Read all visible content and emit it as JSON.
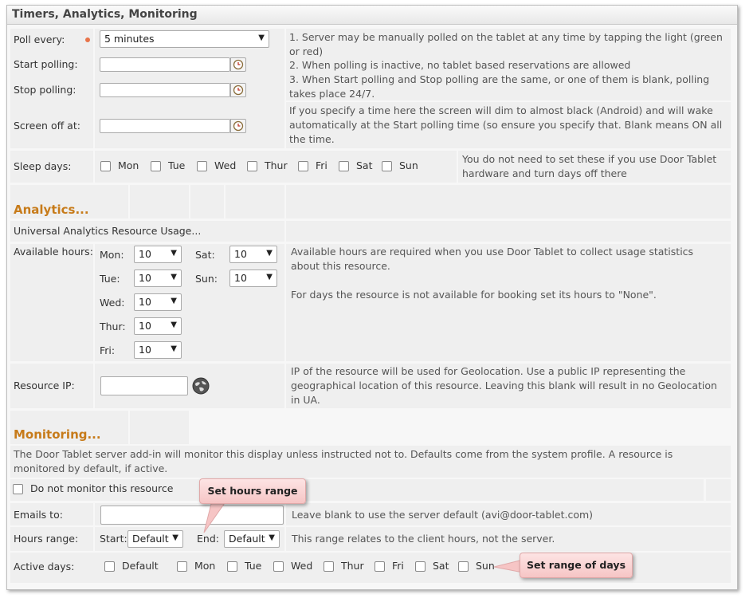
{
  "panel": {
    "title": "Timers, Analytics, Monitoring"
  },
  "timers": {
    "poll_every_label": "Poll every:",
    "poll_every_value": "5 minutes",
    "start_polling_label": "Start polling:",
    "stop_polling_label": "Stop polling:",
    "screen_off_label": "Screen off at:",
    "sleep_days_label": "Sleep days:",
    "poll_notes": [
      "1. Server may be manually polled on the tablet at any time by tapping the light (green or red)",
      "2. When polling is inactive, no tablet based reservations are allowed",
      "3. When Start polling and Stop polling are the same, or one of them is blank, polling takes place 24/7."
    ],
    "screen_off_note": "If you specify a time here the screen will dim to almost black (Android) and will wake automatically at the Start polling time (so ensure you specify that. Blank means ON all the time.",
    "sleep_days": [
      "Mon",
      "Tue",
      "Wed",
      "Thur",
      "Fri",
      "Sat",
      "Sun"
    ],
    "sleep_days_note": "You do not need to set these if you use Door Tablet hardware and turn days off there"
  },
  "analytics": {
    "heading": "Analytics...",
    "ua_label": "Universal Analytics Resource Usage...",
    "available_hours_label": "Available hours:",
    "days": {
      "mon": {
        "label": "Mon:",
        "value": "10"
      },
      "tue": {
        "label": "Tue:",
        "value": "10"
      },
      "wed": {
        "label": "Wed:",
        "value": "10"
      },
      "thur": {
        "label": "Thur:",
        "value": "10"
      },
      "fri": {
        "label": "Fri:",
        "value": "10"
      },
      "sat": {
        "label": "Sat:",
        "value": "10"
      },
      "sun": {
        "label": "Sun:",
        "value": "10"
      }
    },
    "hours_note_1": "Available hours are required when you use Door Tablet to collect usage statistics about this resource.",
    "hours_note_2": "For days the resource is not available for booking set its hours to \"None\".",
    "resource_ip_label": "Resource IP:",
    "resource_ip_note": "IP of the resource will be used for Geolocation. Use a public IP representing the geographical location of this resource. Leaving this blank will result in no Geolocation in UA."
  },
  "monitoring": {
    "heading": "Monitoring...",
    "intro": "The Door Tablet server add-in will monitor this display unless instructed not to. Defaults come from the system profile. A resource is monitored by default, if active.",
    "do_not_monitor_label": "Do not monitor this resource",
    "emails_label": "Emails to:",
    "emails_note": "Leave blank to use the server default (avi@door-tablet.com)",
    "hours_range_label": "Hours range:",
    "start_label": "Start:",
    "start_value": "Default",
    "end_label": "End:",
    "end_value": "Default",
    "hours_range_note": "This range relates to the client hours, not the server.",
    "active_days_label": "Active days:",
    "active_days": [
      "Default",
      "Mon",
      "Tue",
      "Wed",
      "Thur",
      "Fri",
      "Sat",
      "Sun"
    ]
  },
  "callouts": {
    "hours": "Set hours range",
    "days": "Set range of days"
  },
  "colors": {
    "heading": "#c77b1a",
    "required_dot": "#e8744a",
    "callout": "#f6c5c5"
  }
}
